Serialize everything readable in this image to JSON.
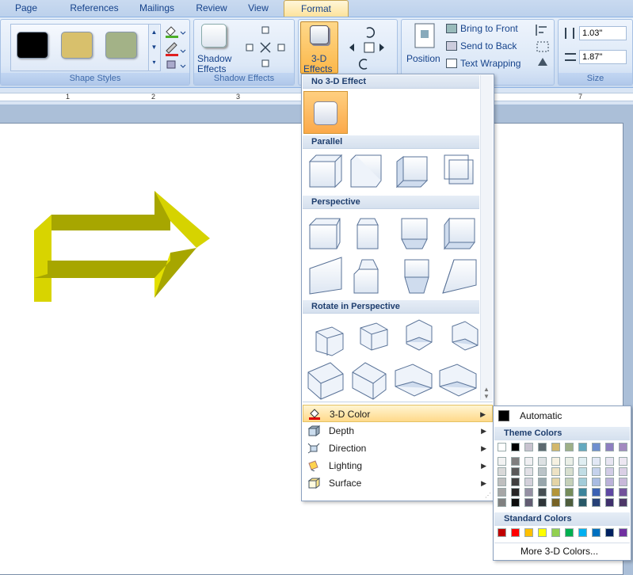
{
  "tabs": [
    "Page Layout",
    "References",
    "Mailings",
    "Review",
    "View",
    "Format"
  ],
  "ribbon": {
    "shape_styles_label": "Shape Styles",
    "swatch_colors": [
      "#000000",
      "#d8c06c",
      "#a3b287"
    ],
    "shadow_effects_btn": "Shadow",
    "shadow_effects_btn2": "Effects",
    "shadow_effects_label": "Shadow Effects",
    "three_d_btn": "3-D",
    "three_d_btn2": "Effects",
    "position_btn": "Position",
    "bring_to_front": "Bring to Front",
    "send_to_back": "Send to Back",
    "text_wrapping": "Text Wrapping",
    "height_value": "1.03\"",
    "width_value": "1.87\"",
    "size_label": "Size"
  },
  "ruler": {
    "numbers": [
      "1",
      "2",
      "3",
      "7"
    ]
  },
  "menu": {
    "sections": [
      "No 3-D Effect",
      "Parallel",
      "Perspective",
      "Rotate in Perspective"
    ],
    "items": [
      {
        "label": "3-D Color",
        "icon": "paint-bucket-icon"
      },
      {
        "label": "Depth",
        "icon": "depth-icon"
      },
      {
        "label": "Direction",
        "icon": "direction-icon"
      },
      {
        "label": "Lighting",
        "icon": "lighting-icon"
      },
      {
        "label": "Surface",
        "icon": "surface-icon"
      }
    ]
  },
  "color_menu": {
    "automatic": "Automatic",
    "theme_colors_label": "Theme Colors",
    "standard_colors_label": "Standard Colors",
    "more_colors": "More 3-D Colors...",
    "theme_top": [
      "#ffffff",
      "#000000",
      "#c8c3cf",
      "#5d6a70",
      "#d2b76b",
      "#9fb088",
      "#65a9bf",
      "#6f8fcf",
      "#8e7fc0",
      "#a389bf"
    ],
    "theme_cols": [
      [
        "#f2f2f2",
        "#d9d9d9",
        "#bfbfbf",
        "#a6a6a6",
        "#808080"
      ],
      [
        "#7f7f7f",
        "#595959",
        "#404040",
        "#262626",
        "#0d0d0d"
      ],
      [
        "#f0eff2",
        "#e2e0e6",
        "#d3d0da",
        "#9590a3",
        "#625c72"
      ],
      [
        "#dde1e3",
        "#bbc4c8",
        "#98a6ac",
        "#464f53",
        "#2f3538"
      ],
      [
        "#f6f1e1",
        "#ede2c4",
        "#e4d4a6",
        "#b39539",
        "#776326"
      ],
      [
        "#ebefe7",
        "#d8dfcf",
        "#c5d0b8",
        "#758c5a",
        "#4e5d3c"
      ],
      [
        "#e0eef2",
        "#c1dde5",
        "#a3ccd9",
        "#3c849b",
        "#285867"
      ],
      [
        "#e2e8f5",
        "#c5d2ec",
        "#a9bce2",
        "#3b62b3",
        "#274177"
      ],
      [
        "#e8e5f2",
        "#d2cce6",
        "#bbb2d9",
        "#5e48a2",
        "#3f306c"
      ],
      [
        "#ede7f2",
        "#dacfe5",
        "#c8b8d9",
        "#73539b",
        "#4d3767"
      ]
    ],
    "standard": [
      "#c00000",
      "#ff0000",
      "#ffc000",
      "#ffff00",
      "#92d050",
      "#00b050",
      "#00b0f0",
      "#0070c0",
      "#002060",
      "#7030a0"
    ]
  }
}
